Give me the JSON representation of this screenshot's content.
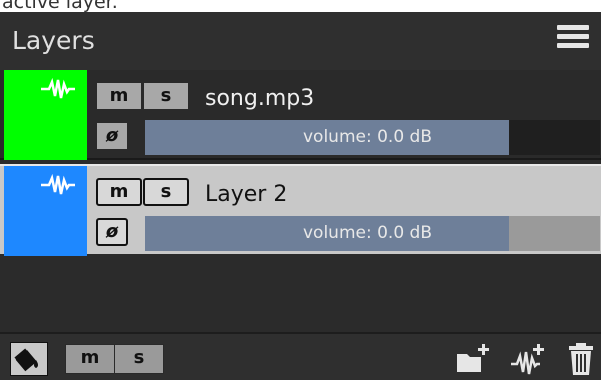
{
  "caption_fragment": "active layer.",
  "panel": {
    "title": "Layers",
    "menu_icon": "hamburger-menu-icon"
  },
  "layers": [
    {
      "name": "song.mp3",
      "color": "#00ff00",
      "selected": false,
      "icon": "waveform-icon",
      "mute_label": "m",
      "solo_label": "s",
      "phase_label": "ø",
      "volume_label": "volume: 0.0 dB",
      "volume_level": 0.8
    },
    {
      "name": "Layer 2",
      "color": "#1e88ff",
      "selected": true,
      "icon": "waveform-icon",
      "mute_label": "m",
      "solo_label": "s",
      "phase_label": "ø",
      "volume_label": "volume: 0.0 dB",
      "volume_level": 0.8
    }
  ],
  "footer": {
    "fill_icon": "paint-bucket-icon",
    "mute_label": "m",
    "solo_label": "s",
    "icons": [
      "new-folder-icon",
      "new-audio-layer-icon",
      "trash-icon"
    ]
  }
}
